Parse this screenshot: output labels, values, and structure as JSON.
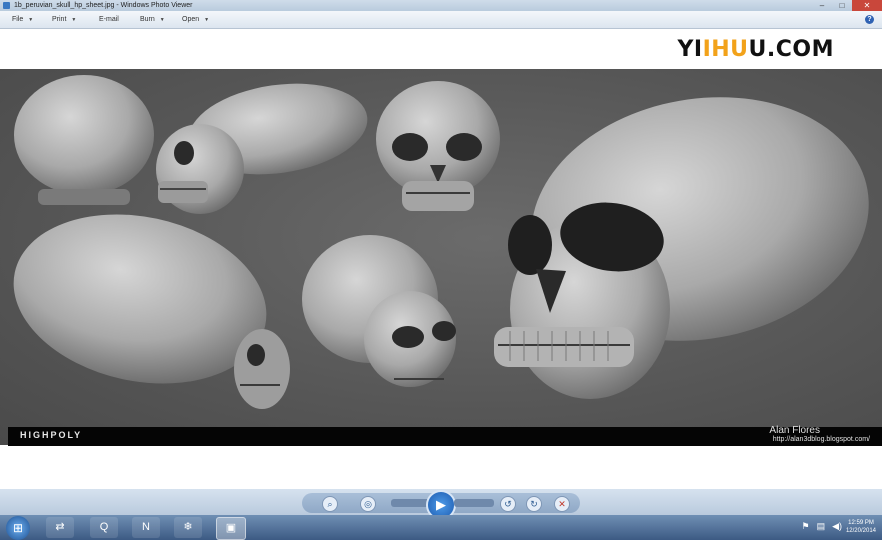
{
  "window": {
    "title": "1b_peruvian_skull_hp_sheet.jpg - Windows Photo Viewer",
    "controls": {
      "minimize": "–",
      "maximize": "□",
      "close": "✕"
    }
  },
  "menu": {
    "items": [
      {
        "label": "File"
      },
      {
        "label": "Print"
      },
      {
        "label": "E-mail"
      },
      {
        "label": "Burn"
      },
      {
        "label": "Open"
      }
    ],
    "help": "?"
  },
  "image": {
    "watermark_prefix": "YI",
    "watermark_accent": "IHU",
    "watermark_suffix": "U.COM",
    "caption_left": "HIGHPOLY",
    "author": "Alan Flores",
    "author_url": "http://alan3dblog.blogspot.com/"
  },
  "taskbar": {
    "clock_time": "12:59 PM",
    "clock_date": "12/20/2014"
  },
  "colors": {
    "accent": "#f2a21a",
    "sheet_bg": "#5a5a5a",
    "taskbar": "#3c5a83"
  }
}
